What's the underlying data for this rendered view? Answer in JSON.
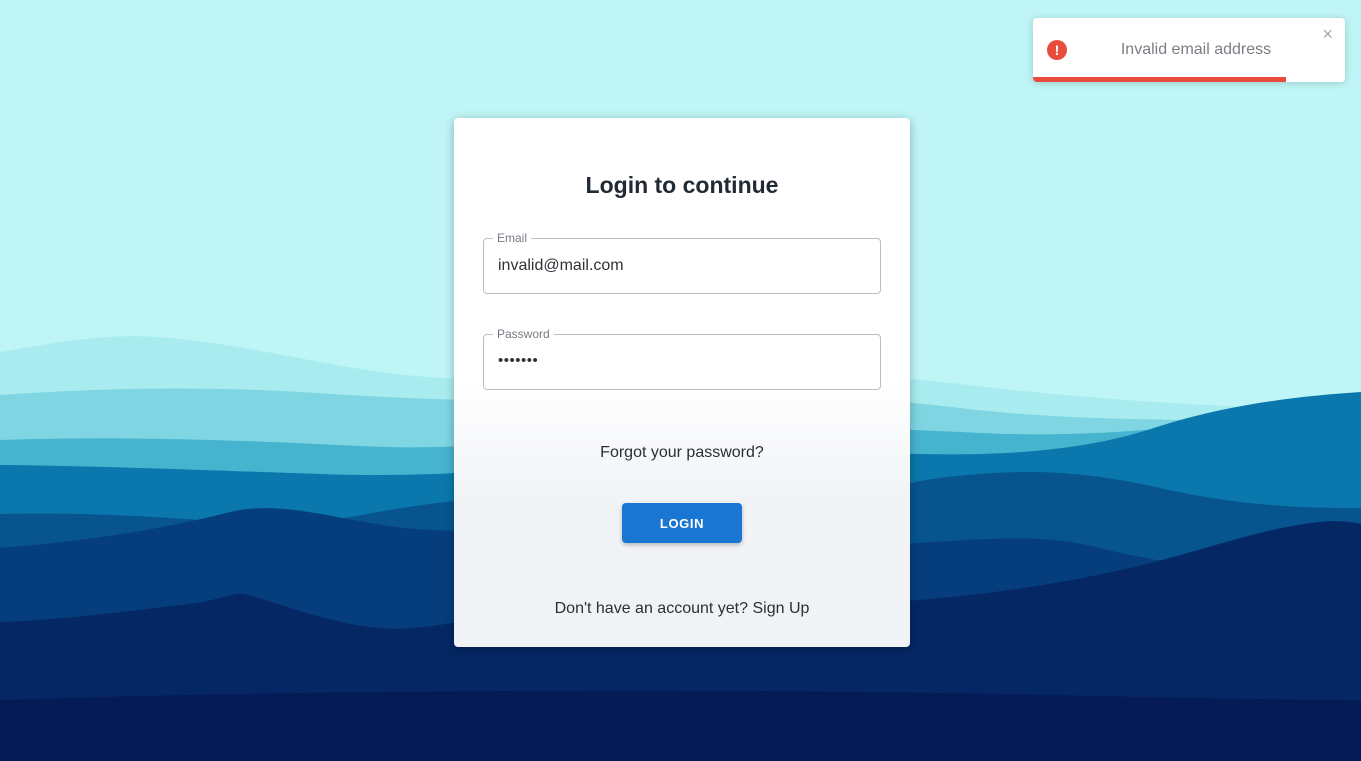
{
  "login": {
    "title": "Login to continue",
    "email_label": "Email",
    "email_value": "invalid@mail.com",
    "password_label": "Password",
    "password_value": "•••••••",
    "forgot_label": "Forgot your password?",
    "login_button": "LOGIN",
    "signup_prompt": "Don't have an account yet?",
    "signup_link": "Sign Up"
  },
  "toast": {
    "icon": "error-icon",
    "glyph": "!",
    "message": "Invalid email address",
    "close_glyph": "×",
    "progress_fraction": 0.81,
    "color": "#e74c3c"
  },
  "colors": {
    "accent": "#1976d2",
    "error": "#e74c3c",
    "sky": "#bff5f6"
  }
}
